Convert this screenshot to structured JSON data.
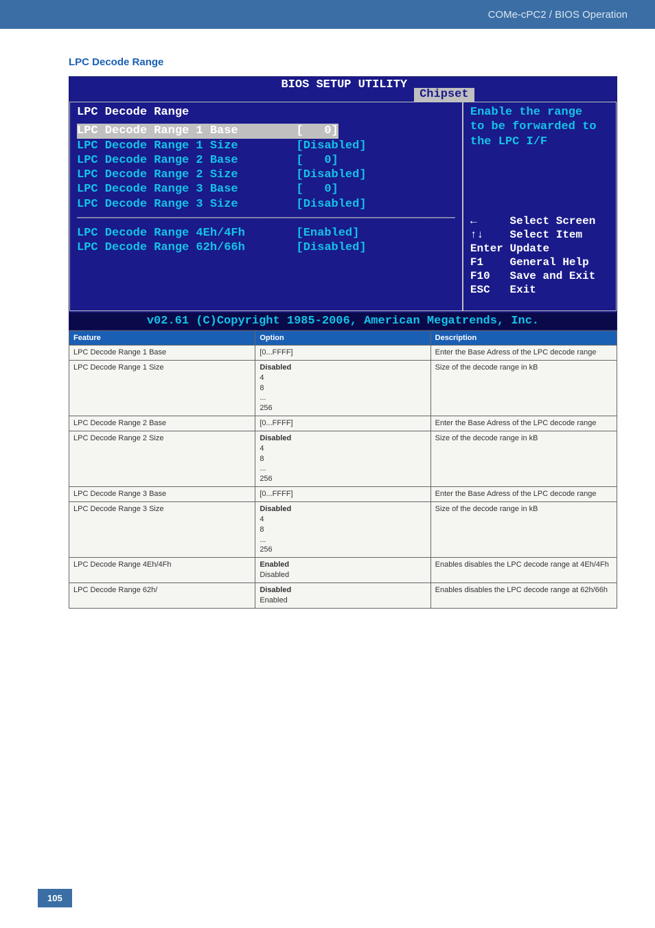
{
  "header": {
    "breadcrumb": "COMe-cPC2 / BIOS Operation"
  },
  "section_title": "LPC Decode Range",
  "bios": {
    "title": "BIOS SETUP UTILITY",
    "tab": "Chipset",
    "heading": "LPC Decode Range",
    "rows_a": [
      {
        "label": "LPC Decode Range 1 Base",
        "value": "[   0]",
        "selected": true
      },
      {
        "label": "LPC Decode Range 1 Size",
        "value": "[Disabled]",
        "selected": false
      },
      {
        "label": "LPC Decode Range 2 Base",
        "value": "[   0]",
        "selected": false
      },
      {
        "label": "LPC Decode Range 2 Size",
        "value": "[Disabled]",
        "selected": false
      },
      {
        "label": "LPC Decode Range 3 Base",
        "value": "[   0]",
        "selected": false
      },
      {
        "label": "LPC Decode Range 3 Size",
        "value": "[Disabled]",
        "selected": false
      }
    ],
    "rows_b": [
      {
        "label": "LPC Decode Range 4Eh/4Fh",
        "value": "[Enabled]"
      },
      {
        "label": "LPC Decode Range 62h/66h",
        "value": "[Disabled]"
      }
    ],
    "help_text": "Enable the range\nto be forwarded to\nthe LPC I/F",
    "nav": "←     Select Screen\n↑↓    Select Item\nEnter Update\nF1    General Help\nF10   Save and Exit\nESC   Exit",
    "footer": "v02.61 (C)Copyright 1985-2006, American Megatrends, Inc."
  },
  "table": {
    "headers": [
      "Feature",
      "Option",
      "Description"
    ],
    "rows": [
      {
        "feature": "LPC Decode Range 1 Base",
        "option_bold": "",
        "option": "[0...FFFF]",
        "desc": "Enter the Base Adress of the LPC decode range"
      },
      {
        "feature": "LPC Decode Range 1 Size",
        "option_bold": "Disabled",
        "option": "4\n8\n...\n256",
        "desc": "Size of the decode range in kB"
      },
      {
        "feature": "LPC Decode Range 2 Base",
        "option_bold": "",
        "option": "[0...FFFF]",
        "desc": "Enter the Base Adress of the LPC decode range"
      },
      {
        "feature": "LPC Decode Range 2 Size",
        "option_bold": "Disabled",
        "option": "4\n8\n...\n256",
        "desc": "Size of the decode range in kB"
      },
      {
        "feature": "LPC Decode Range 3 Base",
        "option_bold": "",
        "option": "[0...FFFF]",
        "desc": "Enter the Base Adress of the LPC decode range"
      },
      {
        "feature": "LPC Decode Range 3 Size",
        "option_bold": "Disabled",
        "option": "4\n8\n...\n256",
        "desc": "Size of the decode range in kB"
      },
      {
        "feature": "LPC Decode Range 4Eh/4Fh",
        "option_bold": "Enabled",
        "option": "Disabled",
        "desc": "Enables disables the LPC decode range at 4Eh/4Fh"
      },
      {
        "feature": "LPC Decode Range 62h/",
        "option_bold": "Disabled",
        "option": "Enabled",
        "desc": "Enables disables the LPC decode range at 62h/66h"
      }
    ]
  },
  "page_number": "105"
}
